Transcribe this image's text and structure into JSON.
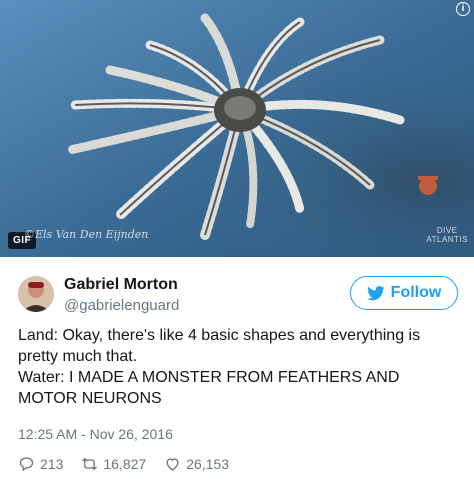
{
  "media": {
    "badge": "GIF",
    "info": "i",
    "credit_left": "©Els Van Den Eijnden",
    "credit_right_line1": "DIVE",
    "credit_right_line2": "ATLANTIS"
  },
  "author": {
    "display_name": "Gabriel Morton",
    "handle": "@gabrielenguard"
  },
  "follow_label": "Follow",
  "tweet": {
    "lines": [
      "Land: Okay, there's like 4 basic shapes and everything is pretty much that.",
      "Water: I MADE A MONSTER FROM FEATHERS AND MOTOR NEURONS"
    ],
    "timestamp": "12:25 AM - Nov 26, 2016"
  },
  "actions": {
    "replies": "213",
    "retweets": "16,827",
    "likes": "26,153"
  },
  "colors": {
    "accent": "#1da1f2",
    "muted": "#657786",
    "text": "#14171a"
  }
}
